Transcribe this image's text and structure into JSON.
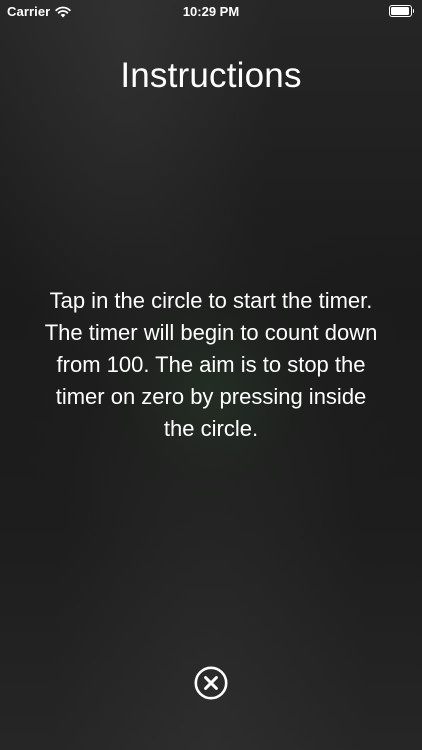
{
  "status_bar": {
    "carrier": "Carrier",
    "time": "10:29 PM",
    "signal_icon": "wifi-icon",
    "battery_icon": "battery-icon"
  },
  "screen": {
    "title": "Instructions",
    "body": "Tap in the circle to start the timer. The timer will begin to count down from 100. The aim is to stop the timer on zero by pressing inside the circle.",
    "close_icon": "close-circle-icon"
  },
  "colors": {
    "background": "#1d1d1d",
    "text": "#ffffff"
  }
}
